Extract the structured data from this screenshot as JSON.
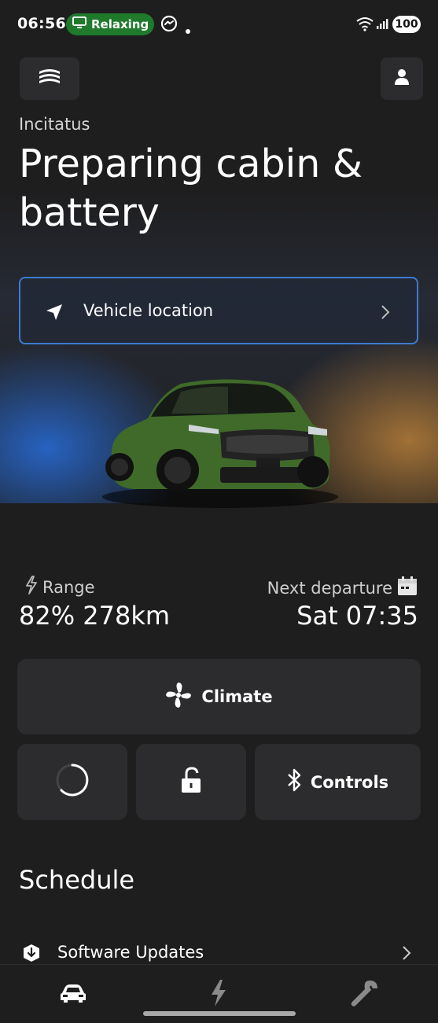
{
  "status_bar": {
    "time": "06:56",
    "focus_mode": "Relaxing",
    "battery": "100"
  },
  "header": {
    "vehicle_name": "Incitatus",
    "status_title": "Preparing cabin & battery"
  },
  "location_button": {
    "label": "Vehicle location"
  },
  "stats": {
    "range_label": "Range",
    "range_value": "82% 278km",
    "departure_label": "Next departure",
    "departure_value": "Sat 07:35"
  },
  "actions": {
    "climate_label": "Climate",
    "controls_label": "Controls"
  },
  "schedule": {
    "heading": "Schedule",
    "items": [
      {
        "label": "Software Updates"
      }
    ]
  },
  "colors": {
    "background": "#1e1e1f",
    "card": "#2c2c2e",
    "accent_blue": "#3d7bd1",
    "focus_green": "#1f7a2c",
    "car_green": "#3f6a2a"
  },
  "icons": {
    "menu": "stacked-layers-icon",
    "profile": "person-icon",
    "location": "navigation-arrow-icon",
    "range": "lightning-icon",
    "departure": "calendar-icon",
    "climate": "fan-icon",
    "progress": "spinner-icon",
    "lock": "unlocked-padlock-icon",
    "controls": "bluetooth-icon",
    "updates": "download-shield-icon",
    "nav": [
      "car-icon",
      "charging-icon",
      "wrench-icon"
    ]
  }
}
